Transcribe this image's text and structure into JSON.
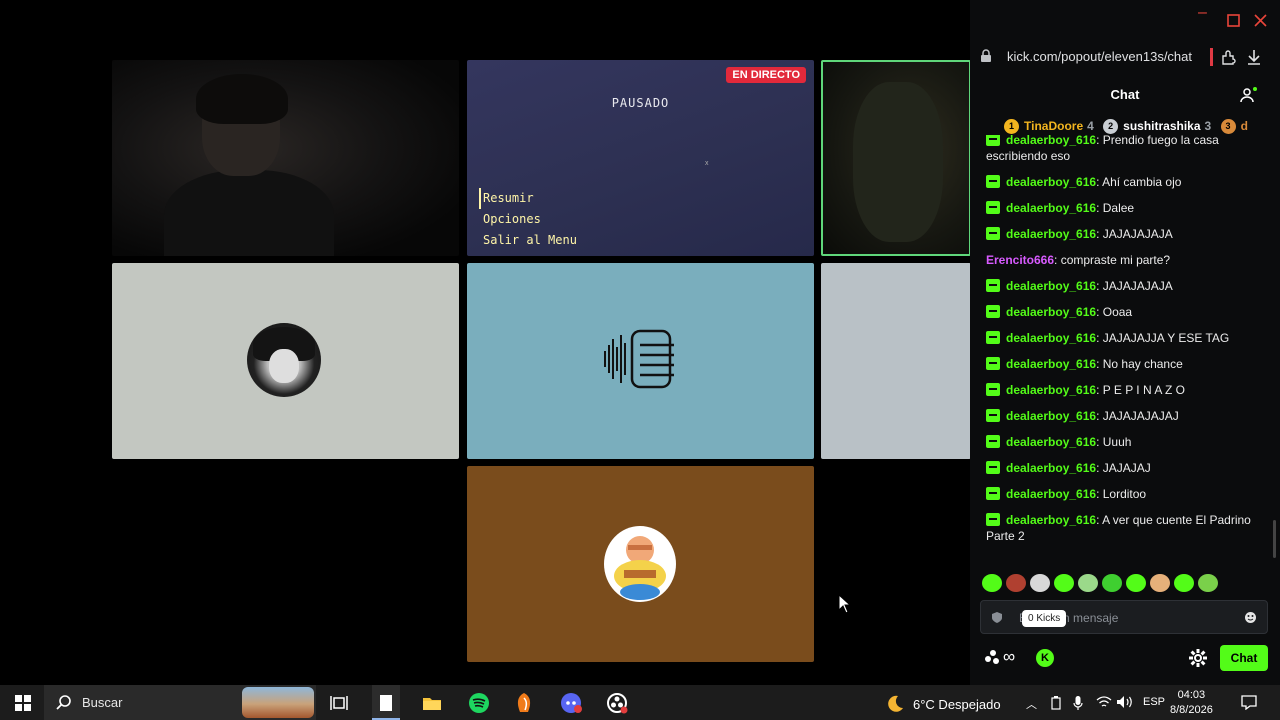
{
  "stream": {
    "live_badge": "EN DIRECTO",
    "pause_title": "PAUSADO",
    "pause_menu": [
      "Resumir",
      "Opciones",
      "Salir al Menu"
    ]
  },
  "browser": {
    "url": "kick.com/popout/eleven13s/chat"
  },
  "chat": {
    "title": "Chat",
    "gifters": [
      {
        "rank": "1",
        "name": "TinaDoore",
        "count": "4",
        "color": "#f3b51f"
      },
      {
        "rank": "2",
        "name": "sushitrashika",
        "count": "3",
        "color": "#c9ced3"
      },
      {
        "rank": "3",
        "name": "d",
        "count": "",
        "color": "#d88a3a"
      }
    ],
    "messages": [
      {
        "user": "dealaerboy_616",
        "text": ": Prendio fuego la casa escribiendo eso",
        "color": "green",
        "partial": true
      },
      {
        "user": "dealaerboy_616",
        "text": ": Ahí cambia ojo",
        "color": "green"
      },
      {
        "user": "dealaerboy_616",
        "text": ": Dalee",
        "color": "green"
      },
      {
        "user": "dealaerboy_616",
        "text": ": JAJAJAJAJA",
        "color": "green"
      },
      {
        "user": "Erencito666",
        "text": ": compraste mi parte?",
        "color": "pink"
      },
      {
        "user": "dealaerboy_616",
        "text": ": JAJAJAJAJA",
        "color": "green"
      },
      {
        "user": "dealaerboy_616",
        "text": ": Ooaa",
        "color": "green"
      },
      {
        "user": "dealaerboy_616",
        "text": ": JAJAJAJJA Y ESE TAG",
        "color": "green"
      },
      {
        "user": "dealaerboy_616",
        "text": ": No hay chance",
        "color": "green"
      },
      {
        "user": "dealaerboy_616",
        "text": ": P E P I N A Z O",
        "color": "green"
      },
      {
        "user": "dealaerboy_616",
        "text": ": JAJAJAJAJAJ",
        "color": "green"
      },
      {
        "user": "dealaerboy_616",
        "text": ": Uuuh",
        "color": "green"
      },
      {
        "user": "dealaerboy_616",
        "text": ": JAJAJAJ",
        "color": "green"
      },
      {
        "user": "dealaerboy_616",
        "text": ": Lorditoo",
        "color": "green"
      },
      {
        "user": "dealaerboy_616",
        "text": ": A ver que cuente El Padrino Parte 2",
        "color": "green"
      }
    ],
    "input_placeholder": "Enviar un mensaje",
    "kicks_tooltip": "0 Kicks",
    "send_label": "Chat",
    "kick_logo_letter": "K"
  },
  "taskbar": {
    "search_label": "Buscar",
    "weather": "6°C Despejado",
    "lang": "ESP",
    "time": "04:03",
    "date": "8/8/2026"
  }
}
